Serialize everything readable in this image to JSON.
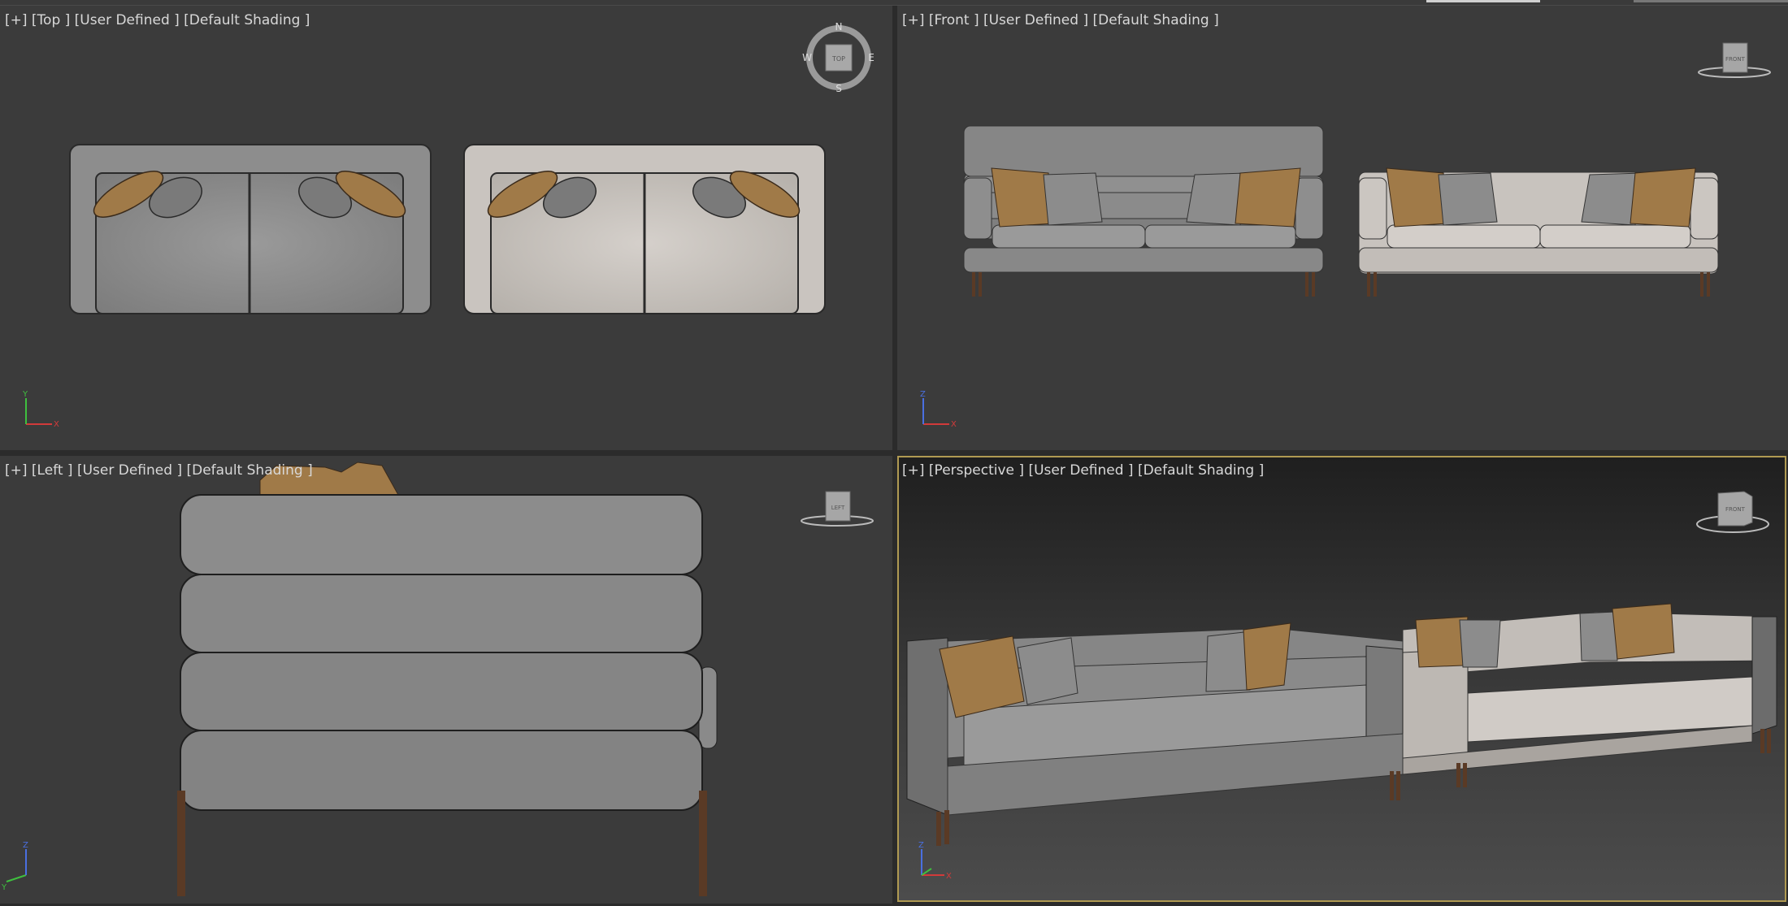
{
  "viewports": {
    "top": {
      "label": "[+] [Top ] [User Defined ] [Default Shading ]"
    },
    "front": {
      "label": "[+] [Front ] [User Defined ] [Default Shading ]"
    },
    "left": {
      "label": "[+] [Left ] [User Defined ] [Default Shading ]"
    },
    "perspective": {
      "label": "[+] [Perspective ] [User Defined ] [Default Shading ]"
    }
  },
  "viewcube": {
    "top": {
      "face": "TOP",
      "north": "N",
      "south": "S",
      "east": "E",
      "west": "W"
    },
    "front": {
      "face": "FRONT"
    },
    "left": {
      "face": "LEFT"
    },
    "perspective": {
      "face": "FRONT"
    }
  },
  "axes": {
    "top": {
      "x": "X",
      "y": "Y"
    },
    "front": {
      "x": "X",
      "z": "Z"
    },
    "left": {
      "y": "Y",
      "z": "Z"
    },
    "perspective": {
      "x": "X",
      "z": "Z"
    }
  },
  "colors": {
    "active_border": "#b09a52",
    "viewport_bg": "#3b3b3b",
    "sofa_grey": "#8a8a8a",
    "sofa_light": "#c9c4bf",
    "pillow_tan": "#a07a48",
    "leg_wood": "#5a3a25",
    "axis_x": "#d23a3a",
    "axis_y": "#3fbf3f",
    "axis_z": "#4a6fe0"
  }
}
